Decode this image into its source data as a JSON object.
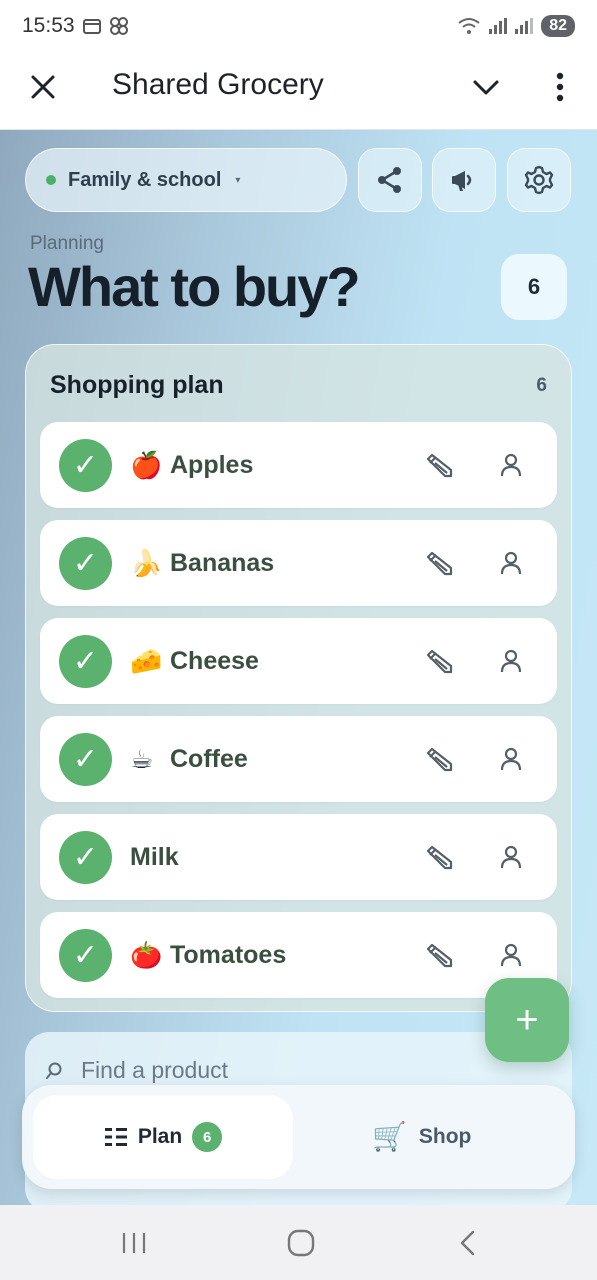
{
  "status_bar": {
    "time": "15:53",
    "battery": "82"
  },
  "header": {
    "title": "Shared Grocery"
  },
  "group": {
    "name": "Family & school",
    "caret": "▾"
  },
  "planning": {
    "subtitle": "Planning",
    "headline": "What to buy?",
    "count": "6"
  },
  "plan_card": {
    "title": "Shopping plan",
    "count": "6",
    "check_glyph": "✓",
    "items": [
      {
        "emoji": "🍎",
        "name": "Apples"
      },
      {
        "emoji": "🍌",
        "name": "Bananas"
      },
      {
        "emoji": "🧀",
        "name": "Cheese"
      },
      {
        "emoji": "☕",
        "name": "Coffee"
      },
      {
        "emoji": "",
        "name": "Milk"
      },
      {
        "emoji": "🍅",
        "name": "Tomatoes"
      }
    ]
  },
  "search": {
    "placeholder": "Find a product"
  },
  "fab": {
    "label": "+"
  },
  "nav": {
    "plan_label": "Plan",
    "plan_badge": "6",
    "shop_label": "Shop",
    "shop_icon": "🛒"
  }
}
